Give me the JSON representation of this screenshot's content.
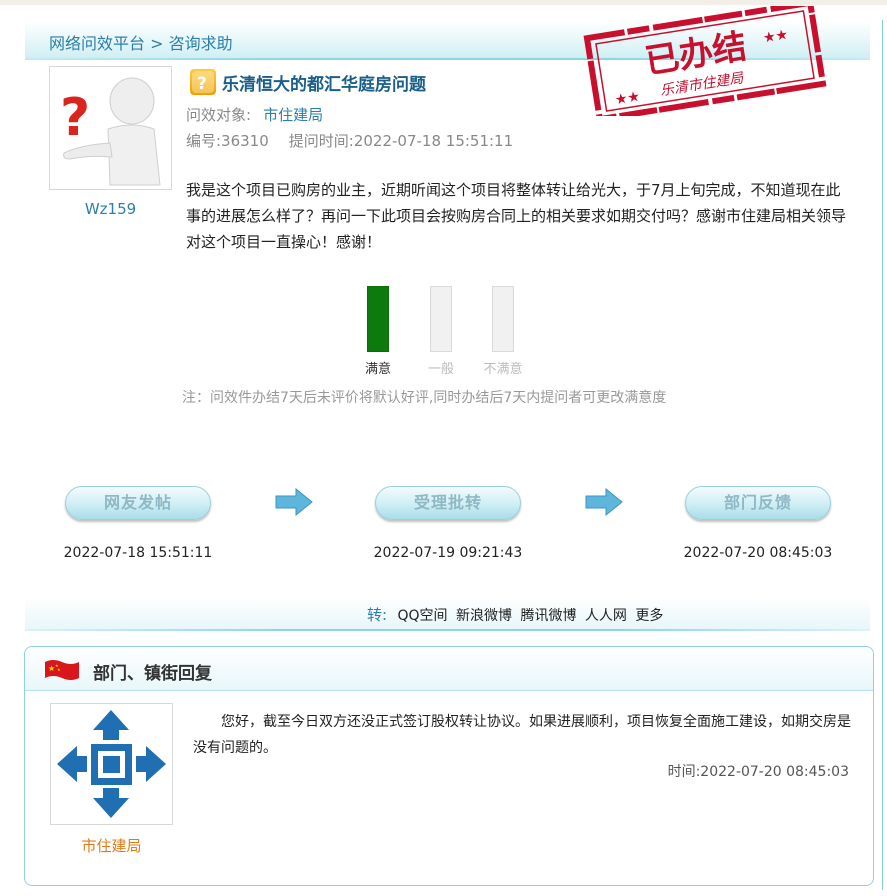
{
  "breadcrumb": {
    "platform": "网络问效平台",
    "separator": " > ",
    "section": "咨询求助"
  },
  "question": {
    "username": "Wz159",
    "title": "乐清恒大的都汇华庭房问题",
    "target_label": "问效对象:",
    "target_dept": "市住建局",
    "number_label": "编号:36310",
    "time_label": "提问时间:2022-07-18 15:51:11",
    "body": "我是这个项目已购房的业主，近期听闻这个项目将整体转让给光大，于7月上旬完成，不知道现在此事的进展怎么样了？再问一下此项目会按购房合同上的相关要求如期交付吗？感谢市住建局相关领导对这个项目一直操心！感谢！"
  },
  "stamp": {
    "main": "已办结",
    "sub": "乐清市住建局"
  },
  "rating": {
    "options": [
      {
        "label": "满意",
        "selected": true
      },
      {
        "label": "一般",
        "selected": false
      },
      {
        "label": "不满意",
        "selected": false
      }
    ],
    "selected_color": "#0d7a0d",
    "note": "注：问效件办结7天后未评价将默认好评,同时办结后7天内提问者可更改满意度"
  },
  "workflow": {
    "steps": [
      {
        "label": "网友发帖",
        "time": "2022-07-18 15:51:11"
      },
      {
        "label": "受理批转",
        "time": "2022-07-19 09:21:43"
      },
      {
        "label": "部门反馈",
        "time": "2022-07-20 08:45:03"
      }
    ]
  },
  "share": {
    "prefix": "转:",
    "links": [
      "QQ空间",
      "新浪微博",
      "腾讯微博",
      "人人网",
      "更多"
    ]
  },
  "reply": {
    "heading": "部门、镇街回复",
    "dept_name": "市住建局",
    "text": "您好，截至今日双方还没正式签订股权转让协议。如果进展顺利，项目恢复全面施工建设，如期交房是没有问题的。",
    "time": "时间:2022-07-20 08:45:03"
  },
  "colors": {
    "link_blue": "#2b7fa8",
    "title_blue": "#1a5f8a",
    "stamp_red": "#c8102e",
    "dept_orange": "#e07b1a"
  }
}
